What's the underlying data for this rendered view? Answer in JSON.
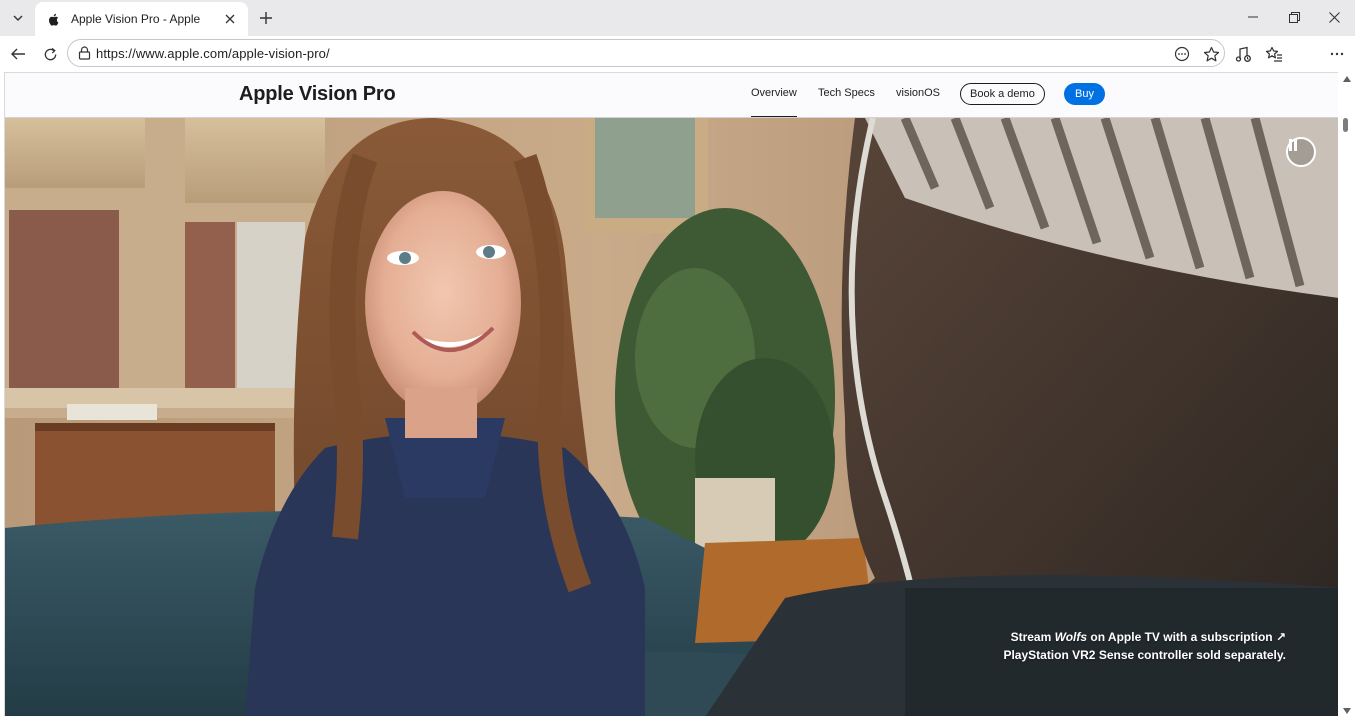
{
  "browser": {
    "tab": {
      "title": "Apple Vision Pro - Apple",
      "favicon": "apple-logo-icon"
    },
    "address": {
      "url": "https://www.apple.com/apple-vision-pro/"
    },
    "icons": {
      "tab_list": "chevron-down-icon",
      "new_tab": "plus-icon",
      "minimize": "minimize-icon",
      "restore": "restore-icon",
      "close": "close-icon",
      "back": "back-arrow-icon",
      "refresh": "refresh-icon",
      "site_info": "lock-icon",
      "more_page": "more-circle-icon",
      "favorite": "star-icon",
      "media": "media-control-icon",
      "favorites": "favorites-list-icon",
      "settings": "more-dots-icon"
    }
  },
  "localnav": {
    "title": "Apple Vision Pro",
    "links": [
      {
        "label": "Overview",
        "active": true
      },
      {
        "label": "Tech Specs",
        "active": false
      },
      {
        "label": "visionOS",
        "active": false
      }
    ],
    "book_demo_label": "Book a demo",
    "buy_label": "Buy"
  },
  "hero": {
    "pause_icon": "pause-icon",
    "caption": {
      "line1_prefix": "Stream ",
      "line1_title": "Wolfs",
      "line1_suffix": " on Apple TV with a subscription ↗",
      "line2": "PlayStation VR2 Sense controller sold separately."
    }
  },
  "colors": {
    "accent": "#0071e3",
    "nav_bg": "#fbfbfd",
    "text": "#1d1d1f"
  }
}
